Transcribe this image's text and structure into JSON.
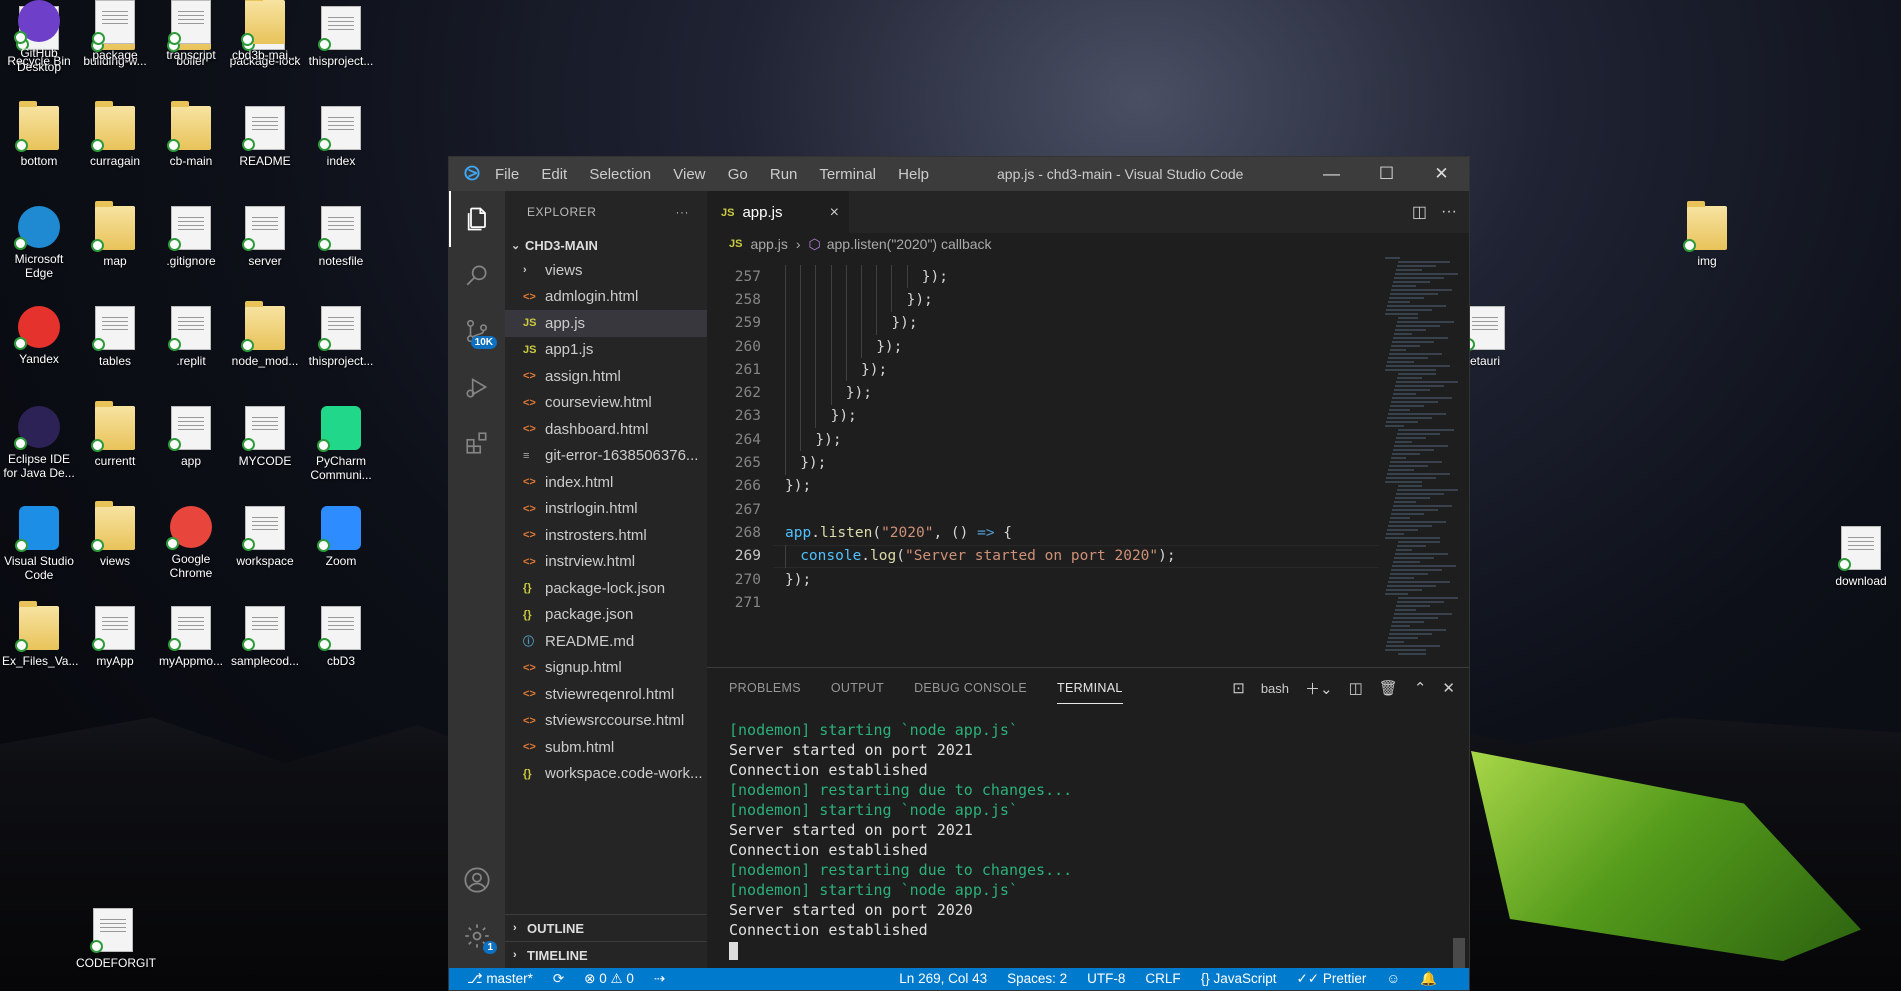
{
  "desktop": {
    "icons": [
      {
        "label": "Recycle Bin",
        "kind": "doc"
      },
      {
        "label": "building-w...",
        "kind": "folder"
      },
      {
        "label": "boiler",
        "kind": "folder"
      },
      {
        "label": "package-lock",
        "kind": "doc"
      },
      {
        "label": "thisproject...",
        "kind": "doc"
      },
      {
        "label": "bottom",
        "kind": "folder"
      },
      {
        "label": "curragain",
        "kind": "folder"
      },
      {
        "label": "cb-main",
        "kind": "folder"
      },
      {
        "label": "README",
        "kind": "doc"
      },
      {
        "label": "index",
        "kind": "doc"
      },
      {
        "label": "Microsoft Edge",
        "kind": "round",
        "color": "#1f8ad2"
      },
      {
        "label": "map",
        "kind": "folder"
      },
      {
        "label": ".gitignore",
        "kind": "doc"
      },
      {
        "label": "server",
        "kind": "doc"
      },
      {
        "label": "notesfile",
        "kind": "doc"
      },
      {
        "label": "Yandex",
        "kind": "round",
        "color": "#e5322d"
      },
      {
        "label": "tables",
        "kind": "doc"
      },
      {
        "label": ".replit",
        "kind": "doc"
      },
      {
        "label": "node_mod...",
        "kind": "folder"
      },
      {
        "label": "thisproject...",
        "kind": "doc"
      },
      {
        "label": "Eclipse IDE for Java De...",
        "kind": "round",
        "color": "#2c2255"
      },
      {
        "label": "currentt",
        "kind": "folder"
      },
      {
        "label": "app",
        "kind": "doc"
      },
      {
        "label": "MYCODE",
        "kind": "doc"
      },
      {
        "label": "PyCharm Communi...",
        "kind": "square",
        "color": "#21d789"
      },
      {
        "label": "Visual Studio Code",
        "kind": "square",
        "color": "#1c8ee6"
      },
      {
        "label": "views",
        "kind": "folder"
      },
      {
        "label": "Google Chrome",
        "kind": "round",
        "color": "#e8453c"
      },
      {
        "label": "workspace",
        "kind": "doc"
      },
      {
        "label": "Zoom",
        "kind": "square",
        "color": "#2d8cff"
      },
      {
        "label": "Ex_Files_Va...",
        "kind": "folder"
      },
      {
        "label": "myApp",
        "kind": "doc"
      },
      {
        "label": "myAppmo...",
        "kind": "doc"
      },
      {
        "label": "samplecod...",
        "kind": "doc"
      },
      {
        "label": "cbD3",
        "kind": "doc"
      },
      {
        "label": "GitHub Desktop",
        "kind": "round",
        "color": "#6e40c9"
      },
      {
        "label": "package",
        "kind": "doc"
      },
      {
        "label": "transcript",
        "kind": "doc"
      },
      {
        "label": "cbd3b-mai...",
        "kind": "folder"
      },
      {
        "label": "CODEFORGIT",
        "kind": "doc"
      },
      {
        "label": "img",
        "kind": "folder"
      },
      {
        "label": "etauri",
        "kind": "doc"
      },
      {
        "label": "download",
        "kind": "doc"
      }
    ]
  },
  "window": {
    "logo": "⧁",
    "menu": [
      "File",
      "Edit",
      "Selection",
      "View",
      "Go",
      "Run",
      "Terminal",
      "Help"
    ],
    "title": "app.js - chd3-main - Visual Studio Code",
    "controls": {
      "minimize": "—",
      "maximize": "☐",
      "close": "✕"
    }
  },
  "activity_bar": {
    "scm_badge": "10K",
    "settings_badge": "1"
  },
  "explorer": {
    "header": "EXPLORER",
    "more": "···",
    "project": "CHD3-MAIN",
    "files": [
      {
        "name": "views",
        "icon": "›",
        "type": "folder"
      },
      {
        "name": "admlogin.html",
        "icon": "<>",
        "type": "html"
      },
      {
        "name": "app.js",
        "icon": "JS",
        "type": "js",
        "selected": true
      },
      {
        "name": "app1.js",
        "icon": "JS",
        "type": "js"
      },
      {
        "name": "assign.html",
        "icon": "<>",
        "type": "html"
      },
      {
        "name": "courseview.html",
        "icon": "<>",
        "type": "html"
      },
      {
        "name": "dashboard.html",
        "icon": "<>",
        "type": "html"
      },
      {
        "name": "git-error-1638506376...",
        "icon": "≡",
        "type": "git"
      },
      {
        "name": "index.html",
        "icon": "<>",
        "type": "html"
      },
      {
        "name": "instrlogin.html",
        "icon": "<>",
        "type": "html"
      },
      {
        "name": "instrosters.html",
        "icon": "<>",
        "type": "html"
      },
      {
        "name": "instrview.html",
        "icon": "<>",
        "type": "html"
      },
      {
        "name": "package-lock.json",
        "icon": "{}",
        "type": "json"
      },
      {
        "name": "package.json",
        "icon": "{}",
        "type": "json"
      },
      {
        "name": "README.md",
        "icon": "ⓘ",
        "type": "md"
      },
      {
        "name": "signup.html",
        "icon": "<>",
        "type": "html"
      },
      {
        "name": "stviewreqenrol.html",
        "icon": "<>",
        "type": "html"
      },
      {
        "name": "stviewsrccourse.html",
        "icon": "<>",
        "type": "html"
      },
      {
        "name": "subm.html",
        "icon": "<>",
        "type": "html"
      },
      {
        "name": "workspace.code-work...",
        "icon": "{}",
        "type": "json"
      }
    ],
    "outline": "OUTLINE",
    "timeline": "TIMELINE"
  },
  "editor": {
    "tab": {
      "icon": "JS",
      "label": "app.js",
      "close": "×"
    },
    "breadcrumb": {
      "file": "app.js",
      "symbol": "app.listen(\"2020\") callback"
    },
    "lines": [
      {
        "n": "257",
        "indent": 9,
        "tokens": [
          [
            "plain",
            "});"
          ]
        ]
      },
      {
        "n": "258",
        "indent": 8,
        "tokens": [
          [
            "plain",
            "});"
          ]
        ]
      },
      {
        "n": "259",
        "indent": 7,
        "tokens": [
          [
            "plain",
            "});"
          ]
        ]
      },
      {
        "n": "260",
        "indent": 6,
        "tokens": [
          [
            "plain",
            "});"
          ]
        ]
      },
      {
        "n": "261",
        "indent": 5,
        "tokens": [
          [
            "plain",
            "});"
          ]
        ]
      },
      {
        "n": "262",
        "indent": 4,
        "tokens": [
          [
            "plain",
            "});"
          ]
        ]
      },
      {
        "n": "263",
        "indent": 3,
        "tokens": [
          [
            "plain",
            "});"
          ]
        ]
      },
      {
        "n": "264",
        "indent": 2,
        "tokens": [
          [
            "plain",
            "});"
          ]
        ]
      },
      {
        "n": "265",
        "indent": 1,
        "tokens": [
          [
            "plain",
            "});"
          ]
        ]
      },
      {
        "n": "266",
        "indent": 0,
        "tokens": [
          [
            "plain",
            "});"
          ]
        ]
      },
      {
        "n": "267",
        "indent": 0,
        "tokens": []
      },
      {
        "n": "268",
        "indent": 0,
        "tokens": [
          [
            "var",
            "app"
          ],
          [
            "plain",
            "."
          ],
          [
            "fn",
            "listen"
          ],
          [
            "plain",
            "("
          ],
          [
            "str",
            "\"2020\""
          ],
          [
            "plain",
            ", () "
          ],
          [
            "kw",
            "=>"
          ],
          [
            "plain",
            " {"
          ]
        ]
      },
      {
        "n": "269",
        "indent": 1,
        "current": true,
        "tokens": [
          [
            "var",
            "console"
          ],
          [
            "plain",
            "."
          ],
          [
            "fn",
            "log"
          ],
          [
            "plain",
            "("
          ],
          [
            "str",
            "\"Server started on port 2020\""
          ],
          [
            "plain",
            ");"
          ]
        ]
      },
      {
        "n": "270",
        "indent": 0,
        "tokens": [
          [
            "plain",
            "});"
          ]
        ]
      },
      {
        "n": "271",
        "indent": 0,
        "tokens": []
      }
    ]
  },
  "panel": {
    "tabs": [
      "PROBLEMS",
      "OUTPUT",
      "DEBUG CONSOLE",
      "TERMINAL"
    ],
    "active_tab": "TERMINAL",
    "shell": "bash",
    "terminal_lines": [
      {
        "text": "[nodemon] starting `node app.js`",
        "color": "green"
      },
      {
        "text": "Server started on port 2021",
        "color": "white"
      },
      {
        "text": "Connection established",
        "color": "white"
      },
      {
        "text": "[nodemon] restarting due to changes...",
        "color": "green"
      },
      {
        "text": "[nodemon] starting `node app.js`",
        "color": "green"
      },
      {
        "text": "Server started on port 2021",
        "color": "white"
      },
      {
        "text": "Connection established",
        "color": "white"
      },
      {
        "text": "[nodemon] restarting due to changes...",
        "color": "green"
      },
      {
        "text": "[nodemon] starting `node app.js`",
        "color": "green"
      },
      {
        "text": "Server started on port 2020",
        "color": "white"
      },
      {
        "text": "Connection established",
        "color": "white"
      }
    ]
  },
  "status_bar": {
    "branch": "master*",
    "errors": "0",
    "warnings": "0",
    "position": "Ln 269, Col 43",
    "spaces": "Spaces: 2",
    "encoding": "UTF-8",
    "eol": "CRLF",
    "language": "JavaScript",
    "formatter": "Prettier"
  },
  "colors": {
    "accent": "#007acc",
    "terminal_green": "#2bb07a"
  }
}
